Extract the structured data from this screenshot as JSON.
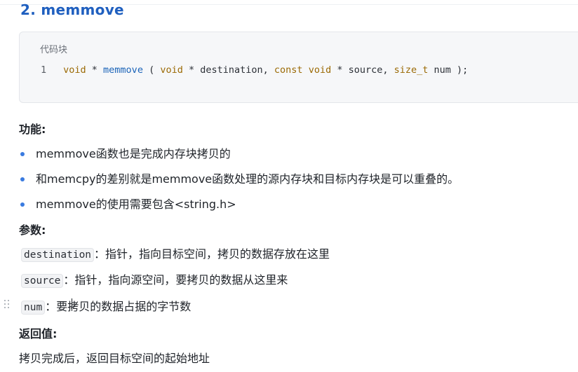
{
  "heading": "2. memmove",
  "code_block": {
    "caption": "代码块",
    "line_number": "1",
    "tokens": {
      "t1": "void",
      "t2": " * ",
      "t3": "memmove",
      "t4": " ( ",
      "t5": "void",
      "t6": " * destination, ",
      "t7": "const",
      "t8": " ",
      "t9": "void",
      "t10": " * source, ",
      "t11": "size_t",
      "t12": " num );"
    }
  },
  "function_section": {
    "title": "功能:",
    "items": [
      "memmove函数也是完成内存块拷贝的",
      "和memcpy的差别就是memmove函数处理的源内存块和目标内存块是可以重叠的。",
      "memmove的使用需要包含<string.h>"
    ]
  },
  "params_section": {
    "title": "参数:",
    "params": [
      {
        "name": "destination",
        "desc": "：指针，指向目标空间，拷贝的数据存放在这里"
      },
      {
        "name": "source",
        "desc": "：指针，指向源空间，要拷贝的数据从这里来"
      },
      {
        "name": "num",
        "desc": "：要拷贝的数据占据的字节数"
      }
    ]
  },
  "return_section": {
    "title": "返回值:",
    "text": "拷贝完成后，返回目标空间的起始地址"
  },
  "colors": {
    "heading": "#1f5fbf",
    "keyword": "#9b6a05",
    "function_name": "#1a63b8",
    "bullet": "#3a7be0",
    "code_background": "#f6f7f9"
  }
}
